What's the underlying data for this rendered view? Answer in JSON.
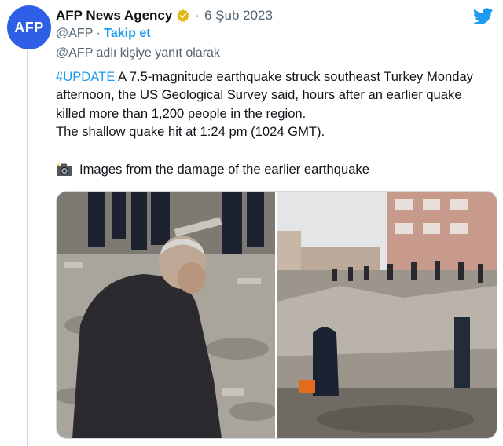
{
  "tweet": {
    "author_name": "AFP News Agency",
    "avatar_text": "AFP",
    "date": "6 Şub 2023",
    "separator": "·",
    "handle": "@AFP",
    "handle_separator": " · ",
    "follow_label": "Takip et",
    "reply_context": "@AFP adlı kişiye yanıt olarak",
    "hashtag": "#UPDATE",
    "body_text": " A 7.5-magnitude earthquake struck southeast Turkey Monday afternoon, the US Geological Survey said, hours after an earlier quake killed more than 1,200 people in the region.",
    "body_line2": "The shallow quake hit at 1:24 pm (1024 GMT).",
    "caption": "Images from the damage of the earlier earthquake"
  },
  "icons": {
    "verified": "verified-badge-icon",
    "brand": "twitter-bird-icon",
    "camera": "camera-flash-icon"
  },
  "colors": {
    "accent": "#1d9bf0",
    "avatar_bg": "#2f5fe6",
    "verified_gold": "#e2b719",
    "muted": "#536471"
  },
  "media": {
    "images": [
      {
        "description_name": "man-kneeling-in-rubble-photo"
      },
      {
        "description_name": "collapsed-building-rescue-photo"
      }
    ]
  }
}
